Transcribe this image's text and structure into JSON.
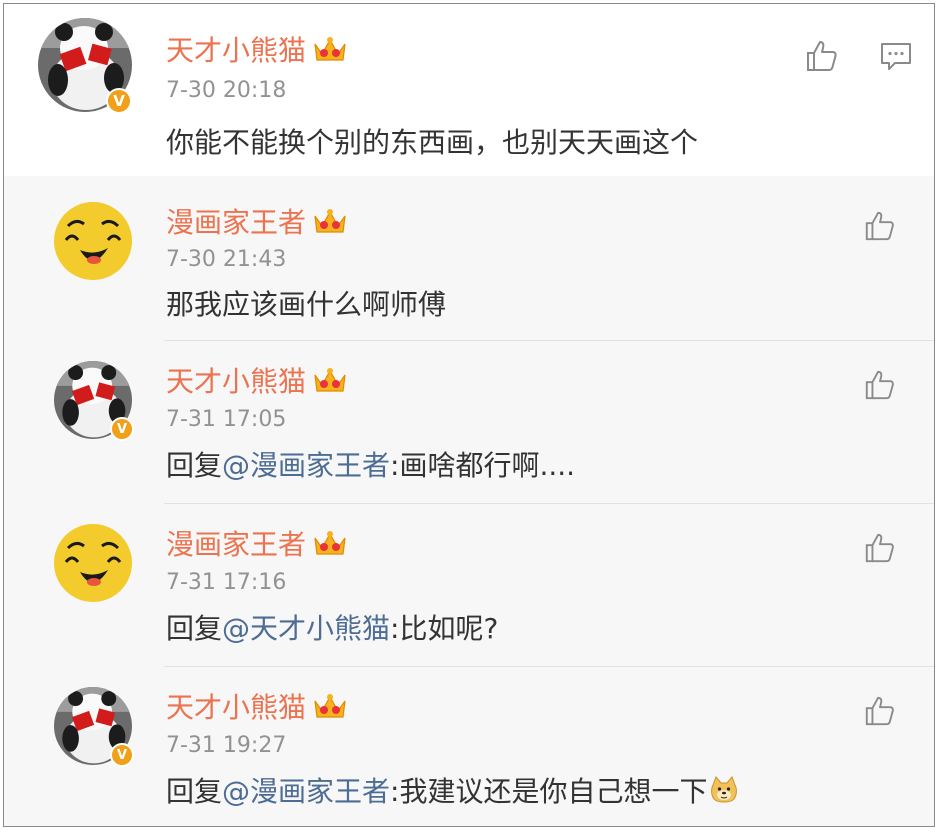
{
  "main_comment": {
    "username": "天才小熊猫",
    "time": "7-30 20:18",
    "text": "你能不能换个别的东西画，也别天天画这个",
    "avatar": "panda-avatar",
    "badge": "V",
    "icons": [
      "like-icon",
      "reply-icon"
    ]
  },
  "replies": [
    {
      "username": "漫画家王者",
      "time": "7-30 21:43",
      "text": "那我应该画什么啊师傅",
      "avatar": "smiley-avatar"
    },
    {
      "username": "天才小熊猫",
      "time": "7-31 17:05",
      "prefix": "回复",
      "mention": "@漫画家王者",
      "text": ":画啥都行啊....",
      "avatar": "panda-avatar",
      "badge": "V"
    },
    {
      "username": "漫画家王者",
      "time": "7-31 17:16",
      "prefix": "回复",
      "mention": "@天才小熊猫",
      "text": ":比如呢?",
      "avatar": "smiley-avatar"
    },
    {
      "username": "天才小熊猫",
      "time": "7-31 19:27",
      "prefix": "回复",
      "mention": "@漫画家王者",
      "text": ":我建议还是你自己想一下",
      "avatar": "panda-avatar",
      "badge": "V",
      "trailing_emoji": "doge-emoji"
    }
  ],
  "colors": {
    "username": "#eb7350",
    "mention": "#4d6d95",
    "time": "#929292",
    "text": "#333333",
    "badge": "#f0a019",
    "reply_bg": "#f7f7f7"
  }
}
